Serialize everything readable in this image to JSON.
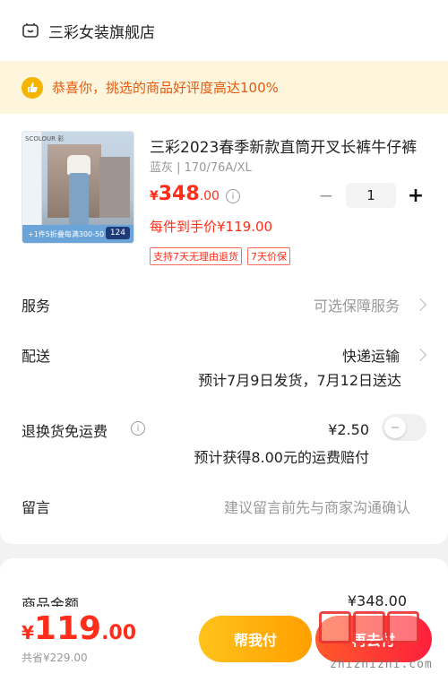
{
  "shop": {
    "name": "三彩女装旗舰店",
    "icon": "shop-icon"
  },
  "banner": {
    "text": "恭喜你，挑选的商品好评度高达100%",
    "icon": "thumbs-up-icon",
    "bg_color": "#fdf5dc",
    "text_color": "#e35a10"
  },
  "product": {
    "title": "三彩2023春季新款直筒开叉长裤牛仔裤",
    "spec": "蓝灰 | 170/76A/XL",
    "price_currency": "¥",
    "price_int": "348",
    "price_dec": ".00",
    "per_price": "每件到手价¥119.00",
    "badges": [
      "支持7天无理由退货",
      "7天价保"
    ],
    "image": {
      "brand": "SCOLOUR 彩",
      "caption": "+1件5折叠每满300-50",
      "tag": "124"
    },
    "quantity": "1",
    "minus": "−",
    "plus": "+"
  },
  "rows": {
    "service": {
      "label": "服务",
      "value": "可选保障服务"
    },
    "delivery": {
      "label": "配送",
      "value": "快递运输",
      "note": "预计7月9日发货，7月12日送达"
    },
    "return_shipping": {
      "label": "退换货免运费",
      "price": "¥2.50",
      "note": "预计获得8.00元的运费赔付",
      "toggle_on": false
    },
    "message": {
      "label": "留言",
      "placeholder": "建议留言前先与商家沟通确认"
    }
  },
  "summary": {
    "label": "商品金额",
    "value": "¥348.00"
  },
  "footer": {
    "total_currency": "¥",
    "total_int": "119",
    "total_dec": ".00",
    "saved": "共省¥229.00",
    "help_button": "帮我付",
    "pay_button": "再去付"
  },
  "watermark": {
    "text": "zhizhizhi.com",
    "chars": [
      "值",
      "值",
      "值"
    ]
  },
  "colors": {
    "accent_red": "#ff2d1a",
    "pay_gradient": "#ff1f3d",
    "help_gradient": "#ffc21a"
  }
}
